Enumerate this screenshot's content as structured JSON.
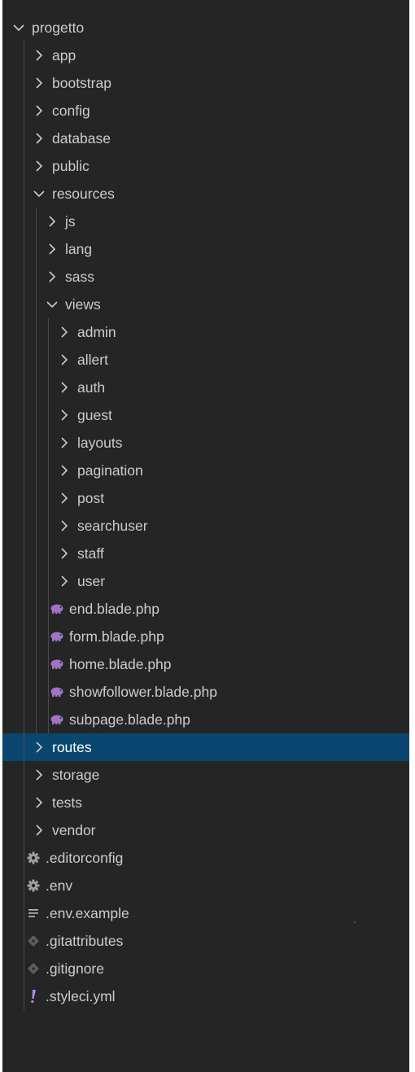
{
  "explorer": {
    "root": {
      "label": "progetto",
      "expanded": true
    },
    "items": [
      {
        "label": "app",
        "kind": "folder",
        "depth": 1,
        "expanded": false
      },
      {
        "label": "bootstrap",
        "kind": "folder",
        "depth": 1,
        "expanded": false
      },
      {
        "label": "config",
        "kind": "folder",
        "depth": 1,
        "expanded": false
      },
      {
        "label": "database",
        "kind": "folder",
        "depth": 1,
        "expanded": false
      },
      {
        "label": "public",
        "kind": "folder",
        "depth": 1,
        "expanded": false
      },
      {
        "label": "resources",
        "kind": "folder",
        "depth": 1,
        "expanded": true
      },
      {
        "label": "js",
        "kind": "folder",
        "depth": 2,
        "expanded": false
      },
      {
        "label": "lang",
        "kind": "folder",
        "depth": 2,
        "expanded": false
      },
      {
        "label": "sass",
        "kind": "folder",
        "depth": 2,
        "expanded": false
      },
      {
        "label": "views",
        "kind": "folder",
        "depth": 2,
        "expanded": true
      },
      {
        "label": "admin",
        "kind": "folder",
        "depth": 3,
        "expanded": false
      },
      {
        "label": "allert",
        "kind": "folder",
        "depth": 3,
        "expanded": false
      },
      {
        "label": "auth",
        "kind": "folder",
        "depth": 3,
        "expanded": false
      },
      {
        "label": "guest",
        "kind": "folder",
        "depth": 3,
        "expanded": false
      },
      {
        "label": "layouts",
        "kind": "folder",
        "depth": 3,
        "expanded": false
      },
      {
        "label": "pagination",
        "kind": "folder",
        "depth": 3,
        "expanded": false
      },
      {
        "label": "post",
        "kind": "folder",
        "depth": 3,
        "expanded": false
      },
      {
        "label": "searchuser",
        "kind": "folder",
        "depth": 3,
        "expanded": false
      },
      {
        "label": "staff",
        "kind": "folder",
        "depth": 3,
        "expanded": false
      },
      {
        "label": "user",
        "kind": "folder",
        "depth": 3,
        "expanded": false
      },
      {
        "label": "end.blade.php",
        "kind": "file",
        "icon": "php-elephant-icon",
        "depth": 3
      },
      {
        "label": "form.blade.php",
        "kind": "file",
        "icon": "php-elephant-icon",
        "depth": 3
      },
      {
        "label": "home.blade.php",
        "kind": "file",
        "icon": "php-elephant-icon",
        "depth": 3
      },
      {
        "label": "showfollower.blade.php",
        "kind": "file",
        "icon": "php-elephant-icon",
        "depth": 3
      },
      {
        "label": "subpage.blade.php",
        "kind": "file",
        "icon": "php-elephant-icon",
        "depth": 3
      },
      {
        "label": "routes",
        "kind": "folder",
        "depth": 1,
        "expanded": false,
        "selected": true
      },
      {
        "label": "storage",
        "kind": "folder",
        "depth": 1,
        "expanded": false
      },
      {
        "label": "tests",
        "kind": "folder",
        "depth": 1,
        "expanded": false
      },
      {
        "label": "vendor",
        "kind": "folder",
        "depth": 1,
        "expanded": false
      },
      {
        "label": ".editorconfig",
        "kind": "file",
        "icon": "gear-icon",
        "depth": 1
      },
      {
        "label": ".env",
        "kind": "file",
        "icon": "gear-icon",
        "depth": 1
      },
      {
        "label": ".env.example",
        "kind": "file",
        "icon": "text-lines-icon",
        "depth": 1
      },
      {
        "label": ".gitattributes",
        "kind": "file",
        "icon": "git-diamond-icon",
        "depth": 1
      },
      {
        "label": ".gitignore",
        "kind": "file",
        "icon": "git-diamond-icon",
        "depth": 1
      },
      {
        "label": ".styleci.yml",
        "kind": "file",
        "icon": "yaml-exclamation-icon",
        "depth": 1
      }
    ]
  },
  "colors": {
    "sidebar_bg": "#252526",
    "text": "#cccccc",
    "selected_bg": "#094771",
    "selected_text": "#ffffff",
    "php_icon": "#a074c4",
    "gear_icon": "#a0a0a0",
    "yaml_icon": "#b28cf0",
    "git_icon": "#5c5c5c",
    "guide": "#4a4a4a"
  }
}
